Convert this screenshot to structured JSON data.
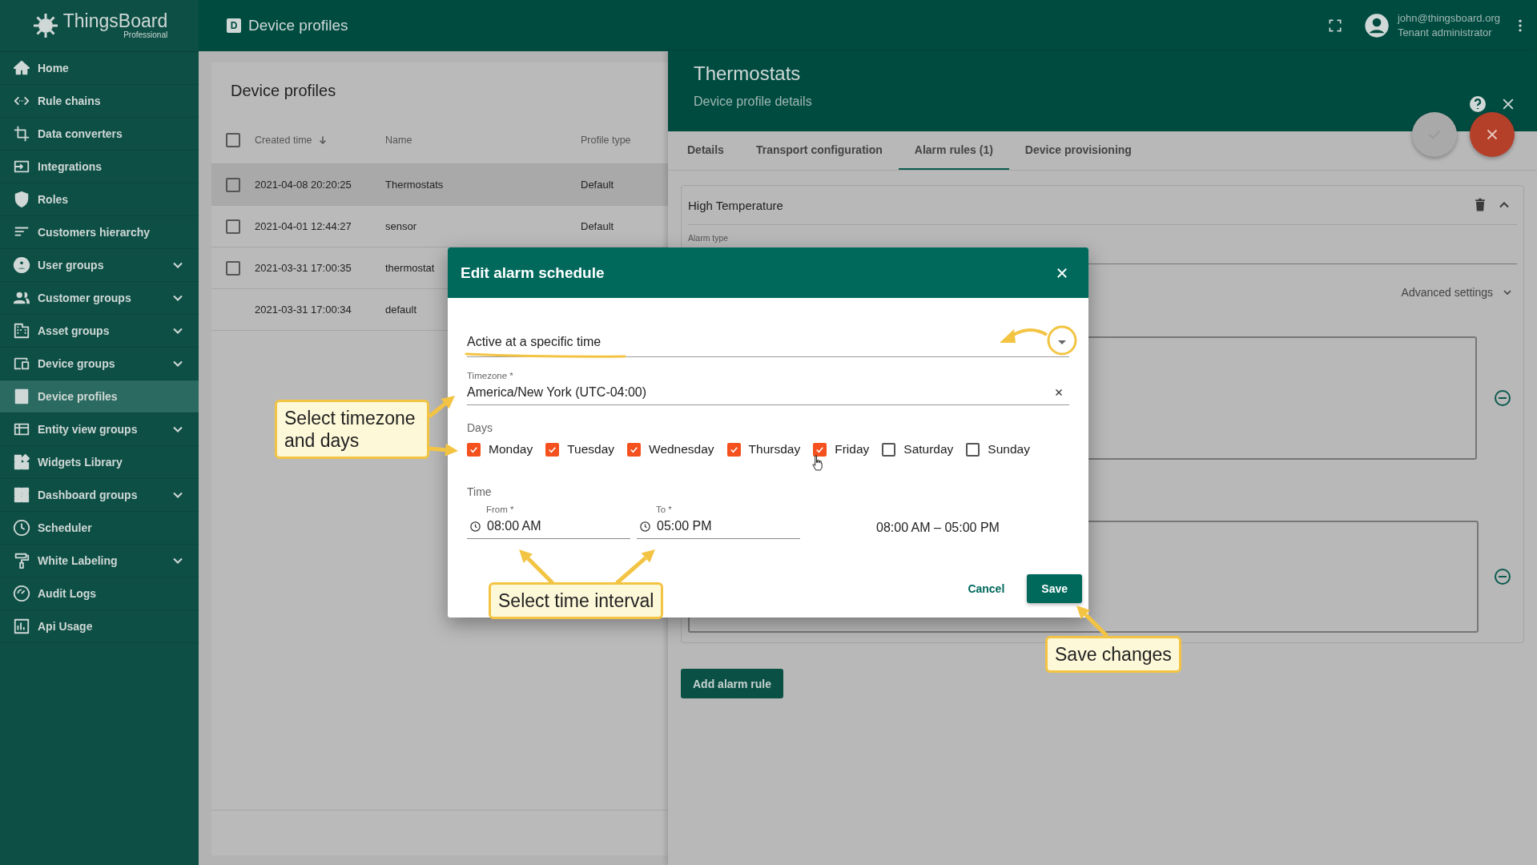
{
  "app": {
    "logo": "ThingsBoard",
    "edition": "Professional"
  },
  "topbar": {
    "page_icon": "D",
    "title": "Device profiles",
    "user_email": "john@thingsboard.org",
    "user_role": "Tenant administrator"
  },
  "sidebar": {
    "items": [
      {
        "label": "Home",
        "selected": false,
        "expandable": false
      },
      {
        "label": "Rule chains",
        "selected": false,
        "expandable": false
      },
      {
        "label": "Data converters",
        "selected": false,
        "expandable": false
      },
      {
        "label": "Integrations",
        "selected": false,
        "expandable": false
      },
      {
        "label": "Roles",
        "selected": false,
        "expandable": false
      },
      {
        "label": "Customers hierarchy",
        "selected": false,
        "expandable": false
      },
      {
        "label": "User groups",
        "selected": false,
        "expandable": true
      },
      {
        "label": "Customer groups",
        "selected": false,
        "expandable": true
      },
      {
        "label": "Asset groups",
        "selected": false,
        "expandable": true
      },
      {
        "label": "Device groups",
        "selected": false,
        "expandable": true
      },
      {
        "label": "Device profiles",
        "selected": true,
        "expandable": false
      },
      {
        "label": "Entity view groups",
        "selected": false,
        "expandable": true
      },
      {
        "label": "Widgets Library",
        "selected": false,
        "expandable": false
      },
      {
        "label": "Dashboard groups",
        "selected": false,
        "expandable": true
      },
      {
        "label": "Scheduler",
        "selected": false,
        "expandable": false
      },
      {
        "label": "White Labeling",
        "selected": false,
        "expandable": true
      },
      {
        "label": "Audit Logs",
        "selected": false,
        "expandable": false
      },
      {
        "label": "Api Usage",
        "selected": false,
        "expandable": false
      }
    ]
  },
  "profiles_table": {
    "title": "Device profiles",
    "header_checked": false,
    "columns": [
      {
        "label": "Created time",
        "sorted": true
      },
      {
        "label": "Name",
        "sorted": false
      },
      {
        "label": "Profile type",
        "sorted": false
      }
    ],
    "rows": [
      {
        "kind": "checkbox",
        "checked": false,
        "selected": true,
        "cells": [
          "2021-04-08 20:20:25",
          "Thermostats",
          "Default"
        ]
      },
      {
        "kind": "checkbox",
        "checked": false,
        "selected": false,
        "cells": [
          "2021-04-01 12:44:27",
          "sensor",
          "Default"
        ]
      },
      {
        "kind": "checkbox",
        "checked": false,
        "selected": false,
        "cells": [
          "2021-03-31 17:00:35",
          "thermostat",
          ""
        ]
      },
      {
        "kind": "plain",
        "selected": false,
        "cells": [
          "2021-03-31 17:00:34",
          "default",
          ""
        ]
      }
    ]
  },
  "details_panel": {
    "title": "Thermostats",
    "subtitle": "Device profile details",
    "tabs": [
      {
        "label": "Details",
        "selected": false
      },
      {
        "label": "Transport configuration",
        "selected": false
      },
      {
        "label": "Alarm rules (1)",
        "selected": true
      },
      {
        "label": "Device provisioning",
        "selected": false
      }
    ],
    "alarm_rule": {
      "name": "High Temperature",
      "alarm_type_label": "Alarm type",
      "advanced_settings": "Advanced settings"
    },
    "add_button": "Add alarm rule"
  },
  "dialog": {
    "title": "Edit alarm schedule",
    "schedule_type": "Active at a specific time",
    "timezone": {
      "label": "Timezone *",
      "value": "America/New York (UTC-04:00)"
    },
    "days_label": "Days",
    "days": [
      {
        "label": "Monday",
        "checked": true
      },
      {
        "label": "Tuesday",
        "checked": true
      },
      {
        "label": "Wednesday",
        "checked": true
      },
      {
        "label": "Thursday",
        "checked": true
      },
      {
        "label": "Friday",
        "checked": true
      },
      {
        "label": "Saturday",
        "checked": false
      },
      {
        "label": "Sunday",
        "checked": false
      }
    ],
    "time_label": "Time",
    "from": {
      "label": "From *",
      "value": "08:00 AM"
    },
    "to": {
      "label": "To *",
      "value": "05:00 PM"
    },
    "range": "08:00 AM – 05:00 PM",
    "cancel": "Cancel",
    "save": "Save"
  },
  "callouts": [
    "Select timezone and days",
    "Select time interval",
    "Save changes"
  ]
}
